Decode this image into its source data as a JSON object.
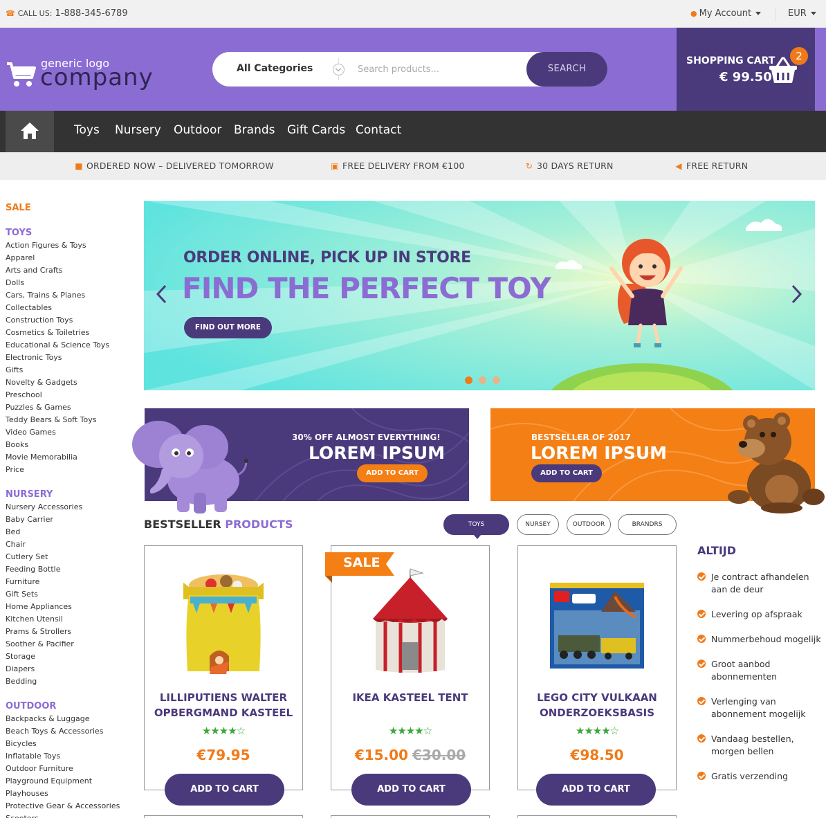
{
  "topbar": {
    "call_label": "CALL US:",
    "phone": "1-888-345-6789",
    "account": "My Account",
    "currency": "EUR"
  },
  "header": {
    "logo_small": "generic logo",
    "logo_big": "company",
    "search": {
      "category": "All Categories",
      "placeholder": "Search products...",
      "button": "SEARCH"
    },
    "cart": {
      "label": "SHOPPING CART",
      "total": "€ 99.50",
      "count": "2"
    }
  },
  "nav": {
    "items": [
      "Toys",
      "Nursery",
      "Outdoor",
      "Brands",
      "Gift Cards",
      "Contact"
    ]
  },
  "usp": [
    {
      "icon": "truck-icon",
      "text": "ORDERED NOW – DELIVERED TOMORROW"
    },
    {
      "icon": "gift-icon",
      "text": "FREE DELIVERY FROM €100"
    },
    {
      "icon": "refresh-icon",
      "text": "30 DAYS RETURN"
    },
    {
      "icon": "backward-icon",
      "text": "FREE RETURN"
    }
  ],
  "sidebar": {
    "sale": "SALE",
    "toys": {
      "title": "TOYS",
      "items": [
        "Action Figures & Toys",
        "Apparel",
        "Arts and Crafts",
        "Dolls",
        "Cars, Trains & Planes",
        "Collectables",
        "Construction Toys",
        "Cosmetics & Toiletries",
        "Educational & Science Toys",
        "Electronic Toys",
        "Gifts",
        "Novelty & Gadgets",
        "Preschool",
        "Puzzles & Games",
        "Teddy Bears & Soft Toys",
        "Video Games",
        "Books",
        "Movie Memorabilia",
        "Price"
      ]
    },
    "nursery": {
      "title": "NURSERY",
      "items": [
        "Nursery Accessories",
        "Baby Carrier",
        "Bed",
        "Chair",
        "Cutlery Set",
        "Feeding Bottle",
        "Furniture",
        "Gift Sets",
        "Home Appliances",
        "Kitchen Utensil",
        "Prams & Strollers",
        "Soother & Pacifier",
        "Storage",
        "Diapers",
        "Bedding"
      ]
    },
    "outdoor": {
      "title": "OUTDOOR",
      "items": [
        "Backpacks & Luggage",
        "Beach Toys & Accessories",
        "Bicycles",
        "Inflatable Toys",
        "Outdoor Furniture",
        "Playground Equipment",
        "Playhouses",
        "Protective Gear & Accessories",
        "Scooters"
      ]
    }
  },
  "hero": {
    "subtitle": "ORDER ONLINE, PICK UP IN  STORE",
    "title": "FIND THE PERFECT TOY",
    "cta": "FIND OUT MORE",
    "slides": 3,
    "active_slide": 1
  },
  "promos": [
    {
      "tag": "30% OFF ALMOST EVERYTHING!",
      "title": "LOREM IPSUM",
      "button": "ADD TO CART"
    },
    {
      "tag": "BESTSELLER OF 2017",
      "title": "LOREM IPSUM",
      "button": "ADD TO CART"
    }
  ],
  "bestseller": {
    "title_a": "BESTSELLER",
    "title_b": "PRODUCTS",
    "tabs": [
      "TOYS",
      "NURSEY",
      "OUTDOOR",
      "BRANDRS"
    ],
    "active_tab": "TOYS",
    "products": [
      {
        "name": "LILLIPUTIENS WALTER OPBERGMAND KASTEEL",
        "rating": 4,
        "price": "€79.95",
        "old_price": "",
        "sale": "",
        "button": "ADD TO CART"
      },
      {
        "name": "IKEA KASTEEL TENT",
        "rating": 4,
        "price": "€15.00",
        "old_price": "€30.00",
        "sale": "SALE",
        "button": "ADD TO CART"
      },
      {
        "name": "LEGO CITY VULKAAN ONDERZOEKSBASIS",
        "rating": 4,
        "price": "€98.50",
        "old_price": "",
        "sale": "",
        "button": "ADD TO CART"
      }
    ]
  },
  "altijd": {
    "title": "ALTIJD",
    "items": [
      "Je contract afhandelen aan de deur",
      "Levering op afspraak",
      "Nummerbehoud mogelijk",
      "Groot aanbod abonnementen",
      "Verlenging van abonnement mogelijk",
      "Vandaag bestellen, morgen bellen",
      "Gratis verzending"
    ]
  },
  "colors": {
    "brand_purple": "#8b6cd3",
    "dark_purple": "#4a3a7c",
    "accent_orange": "#f07a19",
    "star_green": "#3aa83a"
  }
}
